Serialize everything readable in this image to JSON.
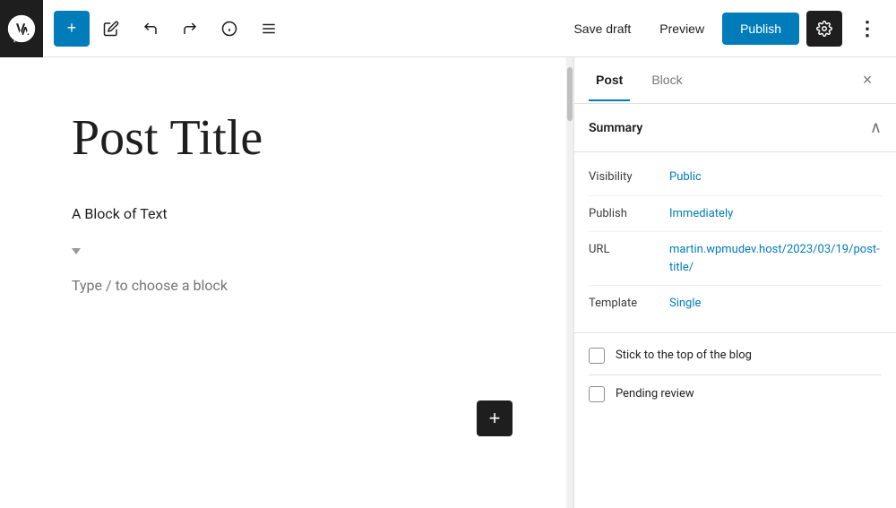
{
  "toolbar": {
    "add_label": "+",
    "save_draft_label": "Save draft",
    "preview_label": "Preview",
    "publish_label": "Publish"
  },
  "editor": {
    "post_title": "Post Title",
    "block_text": "A Block of Text",
    "block_placeholder": "Type / to choose a block",
    "add_block_label": "+"
  },
  "sidebar": {
    "tab_post": "Post",
    "tab_block": "Block",
    "close_label": "×",
    "summary_label": "Summary",
    "rows": [
      {
        "label": "Visibility",
        "value": "Public"
      },
      {
        "label": "Publish",
        "value": "Immediately"
      },
      {
        "label": "URL",
        "value": "martin.wpmudev.host/2023/03/19/post-title/"
      },
      {
        "label": "Template",
        "value": "Single"
      }
    ],
    "checkboxes": [
      {
        "label": "Stick to the top of the blog",
        "checked": false
      },
      {
        "label": "Pending review",
        "checked": false
      }
    ]
  }
}
